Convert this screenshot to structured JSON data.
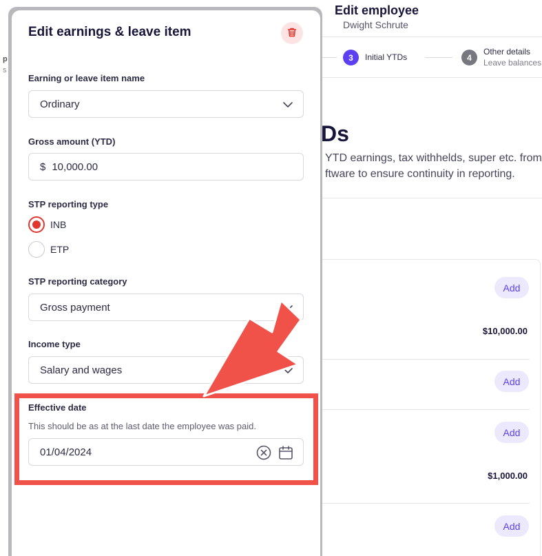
{
  "background": {
    "header": {
      "title": "Edit employee",
      "subtitle": "Dwight Schrute"
    },
    "steps": [
      {
        "number": "3",
        "label": "Initial YTDs"
      },
      {
        "number": "4",
        "label": "Other details",
        "sublabel": "Leave balances,"
      }
    ],
    "left_fragment": "p\ns",
    "heading": "Ds",
    "description_line1": "YTD earnings, tax withhelds, super etc. from",
    "description_line2": "ftware to ensure continuity in reporting.",
    "add_label": "Add",
    "amounts": [
      "$10,000.00",
      "$1,000.00"
    ]
  },
  "modal": {
    "title": "Edit earnings & leave item",
    "fields": {
      "item_name": {
        "label": "Earning or leave item name",
        "value": "Ordinary"
      },
      "gross_amount": {
        "label": "Gross amount (YTD)",
        "prefix": "$",
        "value": "10,000.00"
      },
      "stp_type": {
        "label": "STP reporting type",
        "options": [
          "INB",
          "ETP"
        ],
        "selected": "INB"
      },
      "stp_category": {
        "label": "STP reporting category",
        "value": "Gross payment"
      },
      "income_type": {
        "label": "Income type",
        "value": "Salary and wages"
      },
      "effective_date": {
        "label": "Effective date",
        "hint": "This should be as at the last date the employee was paid.",
        "value": "01/04/2024"
      }
    }
  },
  "colors": {
    "accent": "#5b3ff0",
    "danger": "#e0362e",
    "annotation": "#f0524a"
  },
  "icons": [
    "trash-icon",
    "chevron-down-icon",
    "clear-icon",
    "calendar-icon",
    "annotation-arrow"
  ]
}
